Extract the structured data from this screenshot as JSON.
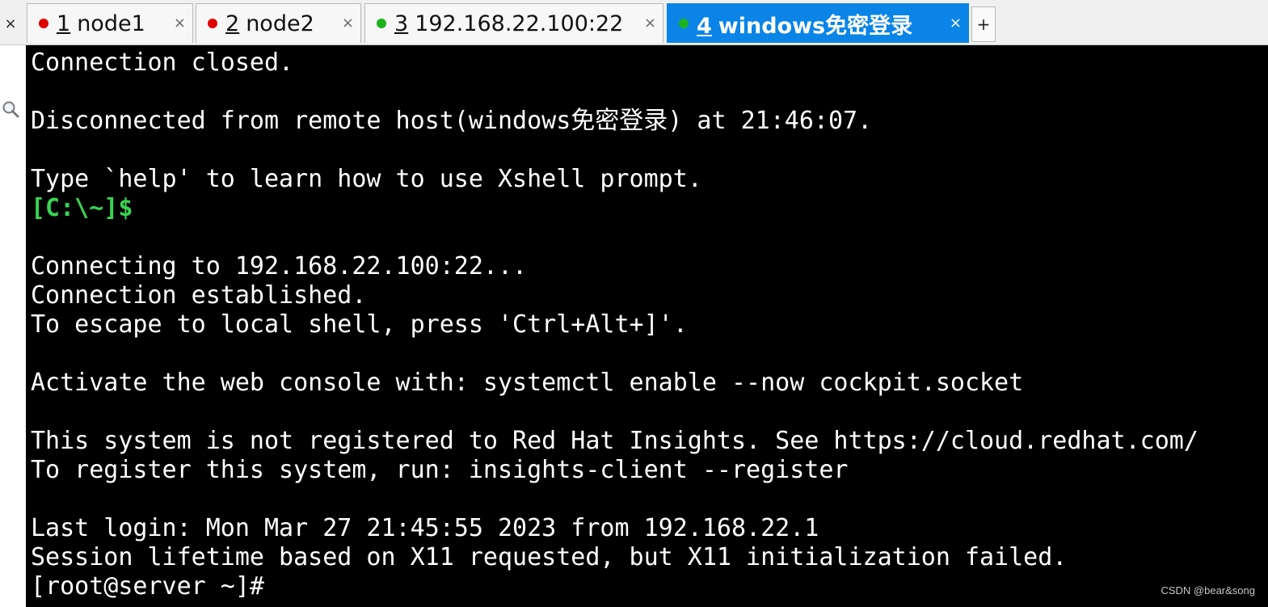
{
  "tabs": [
    {
      "number": "1",
      "label": "node1",
      "status_color": "#e00000",
      "active": false
    },
    {
      "number": "2",
      "label": "node2",
      "status_color": "#e00000",
      "active": false
    },
    {
      "number": "3",
      "label": "192.168.22.100:22",
      "status_color": "#1db31d",
      "active": false
    },
    {
      "number": "4",
      "label": "windows免密登录",
      "status_color": "#1db31d",
      "active": true
    }
  ],
  "tabbar": {
    "close_all": "×",
    "tab_close": "×",
    "new_tab": "+"
  },
  "terminal": {
    "lines": [
      "Connection closed.",
      "",
      "Disconnected from remote host(windows免密登录) at 21:46:07.",
      "",
      "Type `help' to learn how to use Xshell prompt.",
      "[C:\\~]$",
      "",
      "Connecting to 192.168.22.100:22...",
      "Connection established.",
      "To escape to local shell, press 'Ctrl+Alt+]'.",
      "",
      "Activate the web console with: systemctl enable --now cockpit.socket",
      "",
      "This system is not registered to Red Hat Insights. See https://cloud.redhat.com/",
      "To register this system, run: insights-client --register",
      "",
      "Last login: Mon Mar 27 21:45:55 2023 from 192.168.22.1",
      "Session lifetime based on X11 requested, but X11 initialization failed.",
      "[root@server ~]#"
    ],
    "prompt_color": "#39d353"
  },
  "watermark": "CSDN @bear&song",
  "colors": {
    "active_tab": "#0a84e6",
    "terminal_bg": "#000000",
    "terminal_fg": "#ffffff"
  }
}
